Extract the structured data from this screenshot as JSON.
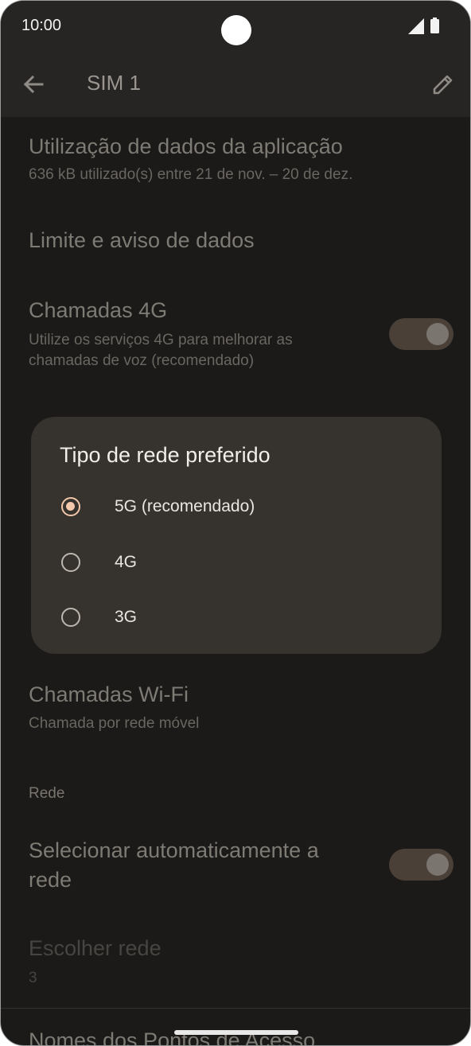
{
  "status": {
    "time": "10:00"
  },
  "appbar": {
    "title": "SIM 1"
  },
  "list": {
    "app_data_usage": {
      "title": "Utilização de dados da aplicação",
      "subtitle": "636 kB utilizado(s) entre 21 de nov. – 20 de dez."
    },
    "data_limit": {
      "title": "Limite e aviso de dados"
    },
    "calls_4g": {
      "title": "Chamadas 4G",
      "subtitle": "Utilize os serviços 4G para melhorar as chamadas de voz (recomendado)",
      "enabled": true
    },
    "wifi_calling": {
      "title": "Chamadas Wi-Fi",
      "subtitle": "Chamada por rede móvel"
    },
    "network_section": "Rede",
    "auto_select": {
      "title": "Selecionar automaticamente a rede",
      "enabled": true
    },
    "choose_network": {
      "title": "Escolher rede",
      "subtitle": "3"
    },
    "apn": {
      "title": "Nomes dos Pontos de Acesso"
    }
  },
  "dialog": {
    "title": "Tipo de rede preferido",
    "options": [
      {
        "label": "5G (recomendado)",
        "selected": true
      },
      {
        "label": "4G",
        "selected": false
      },
      {
        "label": "3G",
        "selected": false
      }
    ]
  },
  "colors": {
    "accent": "#f2c7ab",
    "dialog_bg": "#36322d",
    "screen_bg": "#1b1a18"
  }
}
